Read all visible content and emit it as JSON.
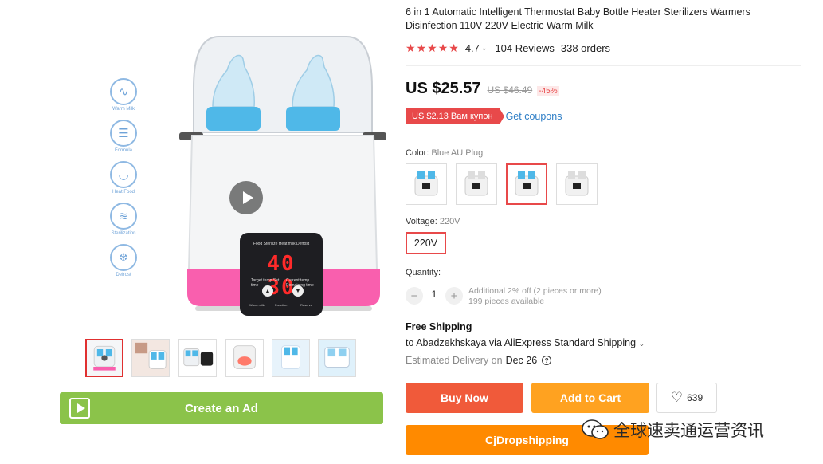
{
  "gallery": {
    "features": [
      {
        "label": "Warm Milk",
        "icon": "bottle-icon",
        "glyph": "∿"
      },
      {
        "label": "Formula",
        "icon": "formula-icon",
        "glyph": "☰"
      },
      {
        "label": "Heat Food",
        "icon": "bowl-icon",
        "glyph": "◡"
      },
      {
        "label": "Sterilization",
        "icon": "steam-icon",
        "glyph": "≋"
      },
      {
        "label": "Defrost",
        "icon": "snowflake-icon",
        "glyph": "❄"
      }
    ],
    "display": {
      "title": "Food Sterilize Heat milk Defrost",
      "digits": "40 30",
      "left_label": "Target temp Set time",
      "right_label": "Current temp Remaining time",
      "btn1": "Warm milk",
      "btn2": "Function",
      "btn3": "Reserve"
    },
    "thumbnail_count": 6,
    "create_ad_label": "Create an Ad"
  },
  "product": {
    "title": "6 in 1 Automatic Intelligent Thermostat Baby Bottle Heater Sterilizers Warmers Disinfection 110V-220V Electric Warm Milk",
    "rating": "4.7",
    "rating_stars": 5,
    "reviews": "104 Reviews",
    "orders": "338 orders",
    "price": "US $25.57",
    "old_price": "US $46.49",
    "discount": "-45%",
    "coupon": "US $2.13 Вам купон",
    "get_coupons": "Get coupons",
    "color_label": "Color:",
    "color_value": "Blue AU Plug",
    "voltage_label": "Voltage:",
    "voltage_value": "220V",
    "voltage_option": "220V",
    "quantity_label": "Quantity:",
    "quantity": "1",
    "qty_note_1": "Additional 2% off (2 pieces or more)",
    "qty_note_2": "199 pieces available",
    "shipping_title": "Free Shipping",
    "shipping_line": "to Abadzekhskaya via AliExpress Standard Shipping",
    "delivery_prefix": "Estimated Delivery on",
    "delivery_date": "Dec 26",
    "buy_now": "Buy Now",
    "add_to_cart": "Add to Cart",
    "wishlist_count": "639",
    "cj_label": "CjDropshipping"
  },
  "watermark": {
    "text": "全球速卖通运营资讯"
  },
  "colors": {
    "accent_red": "#e8494a",
    "buy_now": "#f05a3a",
    "add_to_cart": "#ffa220",
    "cj": "#ff8a00",
    "create_ad": "#8bc34a",
    "link": "#2e7ec6",
    "heater_pink": "#f95fae",
    "bottle_blue": "#4fb8e8"
  }
}
